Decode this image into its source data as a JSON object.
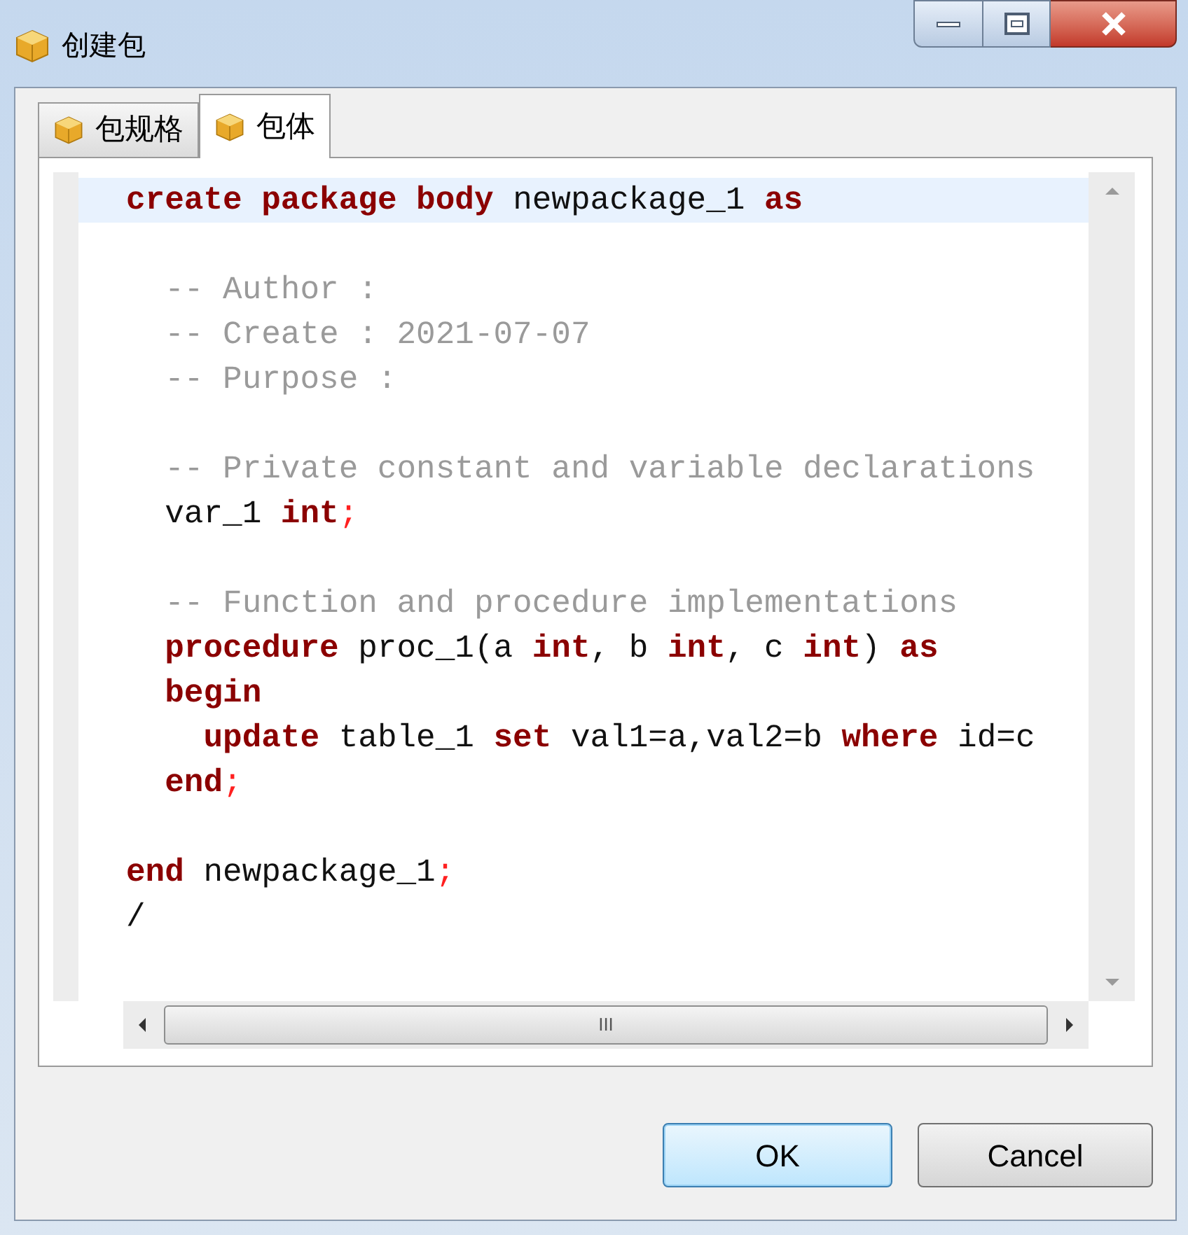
{
  "window": {
    "title": "创建包"
  },
  "tabs": [
    {
      "label": "包规格",
      "selected": false
    },
    {
      "label": "包体",
      "selected": true
    }
  ],
  "editor": {
    "blocks": [
      [
        {
          "current": true,
          "tokens": [
            {
              "kind": "keyword",
              "text": "create"
            },
            {
              "kind": "keyword",
              "text": " package"
            },
            {
              "kind": "keyword",
              "text": " body"
            },
            {
              "kind": "plain",
              "text": " newpackage_1"
            },
            {
              "kind": "keyword",
              "text": " as"
            }
          ]
        }
      ],
      [
        {
          "current": false,
          "tokens": [
            {
              "kind": "comment",
              "text": "  -- Author :"
            }
          ]
        },
        {
          "current": false,
          "tokens": [
            {
              "kind": "comment",
              "text": "  -- Create : 2021-07-07"
            }
          ]
        },
        {
          "current": false,
          "tokens": [
            {
              "kind": "comment",
              "text": "  -- Purpose :"
            }
          ]
        }
      ],
      [
        {
          "current": false,
          "tokens": [
            {
              "kind": "comment",
              "text": "  -- Private constant and variable declarations"
            }
          ]
        },
        {
          "current": false,
          "tokens": [
            {
              "kind": "plain",
              "text": "  var_1"
            },
            {
              "kind": "keyword",
              "text": " int"
            },
            {
              "kind": "punct",
              "text": ";"
            }
          ]
        }
      ],
      [
        {
          "current": false,
          "tokens": [
            {
              "kind": "comment",
              "text": "  -- Function and procedure implementations"
            }
          ]
        },
        {
          "current": false,
          "tokens": [
            {
              "kind": "keyword",
              "text": "  procedure"
            },
            {
              "kind": "plain",
              "text": " proc_1(a"
            },
            {
              "kind": "keyword",
              "text": " int"
            },
            {
              "kind": "plain",
              "text": ", b"
            },
            {
              "kind": "keyword",
              "text": " int"
            },
            {
              "kind": "plain",
              "text": ", c"
            },
            {
              "kind": "keyword",
              "text": " int"
            },
            {
              "kind": "plain",
              "text": ")"
            },
            {
              "kind": "keyword",
              "text": " as"
            }
          ]
        },
        {
          "current": false,
          "tokens": [
            {
              "kind": "keyword",
              "text": "  begin"
            }
          ]
        },
        {
          "current": false,
          "tokens": [
            {
              "kind": "keyword",
              "text": "    update"
            },
            {
              "kind": "plain",
              "text": " table_1"
            },
            {
              "kind": "keyword",
              "text": " set"
            },
            {
              "kind": "plain",
              "text": " val1=a,val2=b"
            },
            {
              "kind": "keyword",
              "text": " where"
            },
            {
              "kind": "plain",
              "text": " id=c"
            }
          ]
        },
        {
          "current": false,
          "tokens": [
            {
              "kind": "keyword",
              "text": "  end"
            },
            {
              "kind": "punct",
              "text": ";"
            }
          ]
        }
      ],
      [
        {
          "current": false,
          "tokens": [
            {
              "kind": "keyword",
              "text": "end"
            },
            {
              "kind": "plain",
              "text": " newpackage_1"
            },
            {
              "kind": "punct",
              "text": ";"
            }
          ]
        },
        {
          "current": false,
          "tokens": [
            {
              "kind": "plain",
              "text": "/"
            }
          ]
        }
      ]
    ]
  },
  "scrollbar": {
    "grip": "III"
  },
  "buttons": [
    {
      "label": "OK",
      "default": true
    },
    {
      "label": "Cancel",
      "default": false
    }
  ]
}
